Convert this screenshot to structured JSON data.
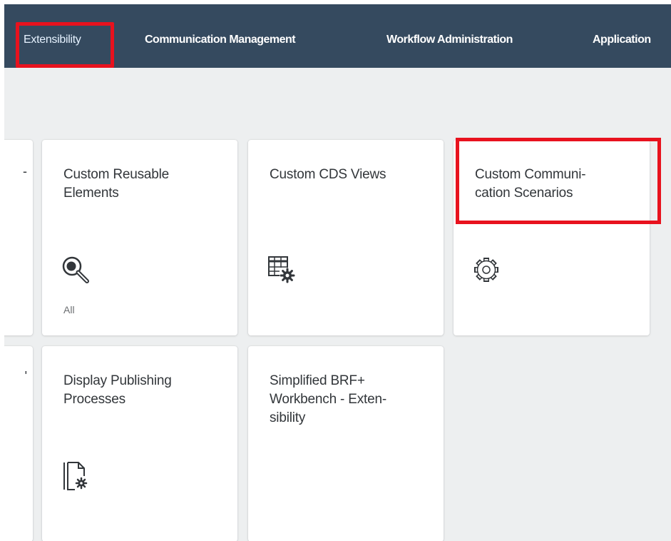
{
  "nav": {
    "items": [
      {
        "label": "Extensibility",
        "active": true
      },
      {
        "label": "Communication Management"
      },
      {
        "label": "Workflow Administration"
      },
      {
        "label": "Application"
      }
    ]
  },
  "tiles": [
    {
      "title": "Custom Reusable Elements",
      "icon": "search-magnifier-icon",
      "footer": "All"
    },
    {
      "title": "Custom CDS Views",
      "icon": "table-settings-icon"
    },
    {
      "title": "Custom Communi-\ncation Scenarios",
      "icon": "gear-icon"
    },
    {
      "title": "Display Publishing Processes",
      "icon": "document-settings-icon"
    },
    {
      "title": "Simplified BRF+ Workbench - Exten-\nsibility"
    }
  ],
  "cut_tiles": [
    {
      "glyph": "-"
    },
    {
      "glyph": "'"
    }
  ],
  "colors": {
    "shell_bar": "#354a5f",
    "highlight": "#e8121e",
    "background": "#edeff0",
    "tile": "#ffffff",
    "text": "#32363a",
    "icon": "#32363a"
  }
}
